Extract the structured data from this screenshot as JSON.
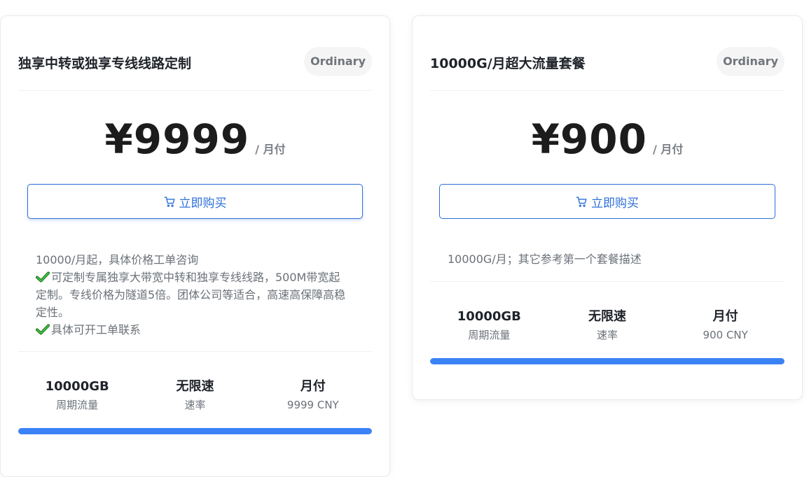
{
  "plans": [
    {
      "title": "独享中转或独享专线线路定制",
      "badge": "Ordinary",
      "price": "¥9999",
      "period": "/ 月付",
      "buy_label": "立即购买",
      "description": {
        "line1": "10000/月起，具体价格工单咨询",
        "line2": "可定制专属独享大带宽中转和独享专线线路，500M带宽起定制。专线价格为隧道5倍。团体公司等适合，高速高保障高稳定性。",
        "line3": "具体可开工单联系"
      },
      "stats": {
        "traffic_value": "10000GB",
        "traffic_label": "周期流量",
        "speed_value": "无限速",
        "speed_label": "速率",
        "cycle_value": "月付",
        "cycle_label": "9999 CNY"
      },
      "progress": 1.0
    },
    {
      "title": "10000G/月超大流量套餐",
      "badge": "Ordinary",
      "price": "¥900",
      "period": "/ 月付",
      "buy_label": "立即购买",
      "description": {
        "line1": "10000G/月；其它参考第一个套餐描述"
      },
      "stats": {
        "traffic_value": "10000GB",
        "traffic_label": "周期流量",
        "speed_value": "无限速",
        "speed_label": "速率",
        "cycle_value": "月付",
        "cycle_label": "900 CNY"
      },
      "progress": 1.0
    }
  ],
  "icons": {
    "buy": "cart-icon",
    "feature": "checkmark-icon"
  },
  "colors": {
    "accent": "#2d6fd8",
    "progress": "#3b82f6",
    "check": "#16a34a"
  }
}
